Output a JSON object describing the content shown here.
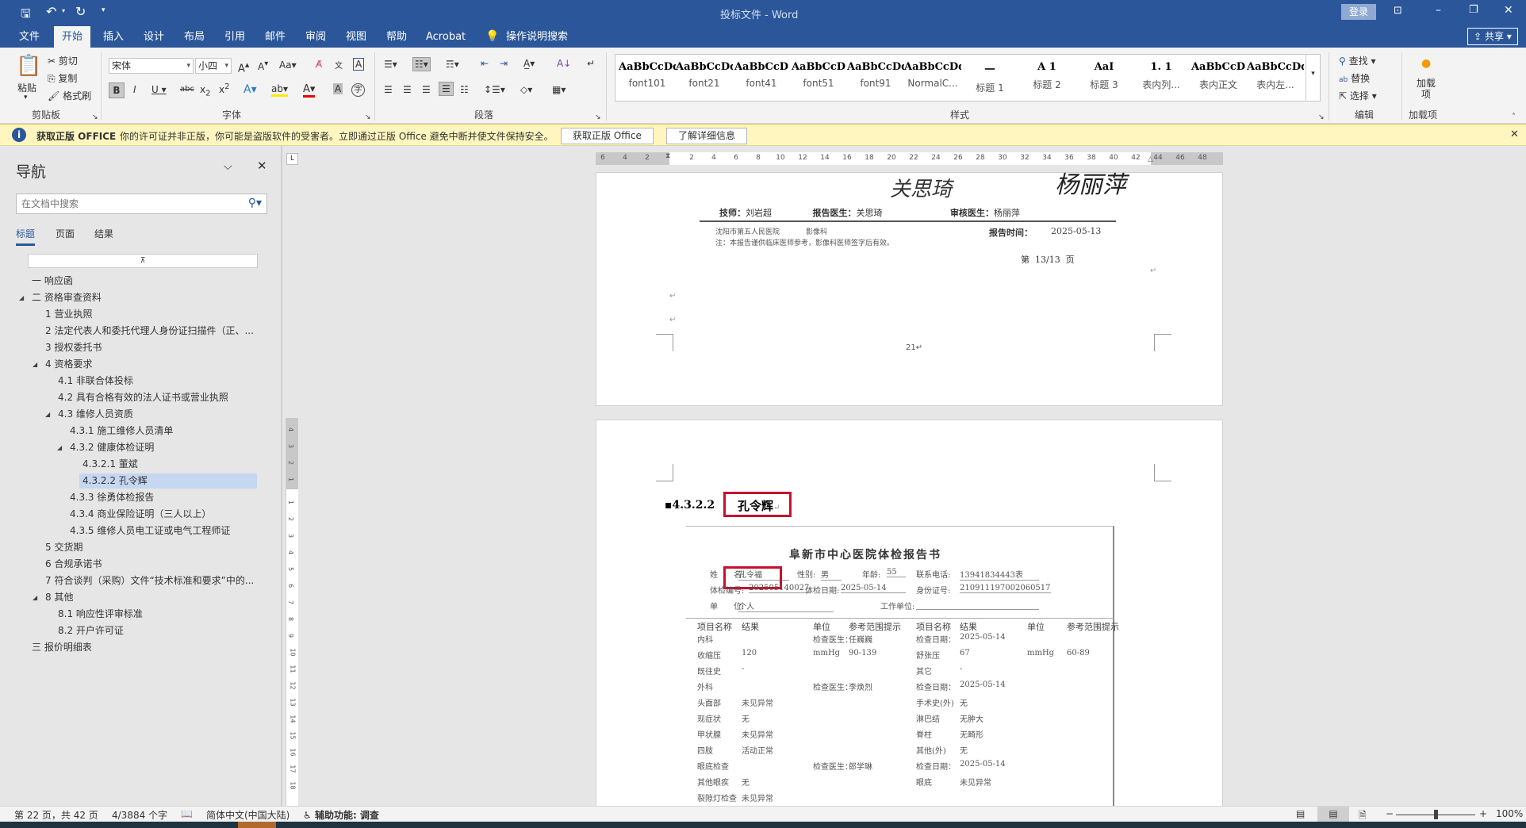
{
  "titlebar": {
    "title": "投标文件 - Word",
    "login": "登录",
    "share": "共享"
  },
  "tabs": [
    "文件",
    "开始",
    "插入",
    "设计",
    "布局",
    "引用",
    "邮件",
    "审阅",
    "视图",
    "帮助",
    "Acrobat"
  ],
  "tell_me": "操作说明搜索",
  "ribbon": {
    "clipboard": {
      "paste": "粘贴",
      "cut": "剪切",
      "copy": "复制",
      "format_painter": "格式刷",
      "label": "剪贴板"
    },
    "font": {
      "name": "宋体",
      "size": "小四",
      "label": "字体"
    },
    "paragraph": {
      "label": "段落"
    },
    "styles": {
      "label": "样式",
      "items": [
        {
          "preview": "AaBbCcDd",
          "name": "font101"
        },
        {
          "preview": "AaBbCcDdI",
          "name": "font21"
        },
        {
          "preview": "AaBbCcD",
          "name": "font41"
        },
        {
          "preview": "AaBbCcD",
          "name": "font51"
        },
        {
          "preview": "AaBbCcDd",
          "name": "font91"
        },
        {
          "preview": "AaBbCcDd",
          "name": "NormalC..."
        },
        {
          "preview": "一",
          "name": "标题 1"
        },
        {
          "preview": "A 1",
          "name": "标题 2"
        },
        {
          "preview": "AaI",
          "name": "标题 3"
        },
        {
          "preview": "1. 1",
          "name": "表内列..."
        },
        {
          "preview": "AaBbCcD",
          "name": "表内正文"
        },
        {
          "preview": "AaBbCcDd",
          "name": "表内左..."
        }
      ]
    },
    "editing": {
      "find": "查找",
      "replace": "替换",
      "select": "选择",
      "label": "编辑"
    },
    "addins": {
      "button": "加载项",
      "label": "加载项"
    }
  },
  "infobar": {
    "title": "获取正版 OFFICE",
    "message": "你的许可证并非正版，你可能是盗版软件的受害者。立即通过正版 Office 避免中断并使文件保持安全。",
    "btn_get": "获取正版 Office",
    "btn_learn": "了解详细信息"
  },
  "nav": {
    "title": "导航",
    "search_placeholder": "在文档中搜索",
    "tabs": [
      "标题",
      "页面",
      "结果"
    ],
    "items": [
      {
        "label": "一 响应函",
        "level": 0,
        "exp": false
      },
      {
        "label": "二 资格审查资料",
        "level": 0,
        "exp": true
      },
      {
        "label": "1 营业执照",
        "level": 1,
        "exp": false
      },
      {
        "label": "2 法定代表人和委托代理人身份证扫描件（正、...",
        "level": 1,
        "exp": false
      },
      {
        "label": "3 授权委托书",
        "level": 1,
        "exp": false
      },
      {
        "label": "4 资格要求",
        "level": 1,
        "exp": true
      },
      {
        "label": "4.1 非联合体投标",
        "level": 2,
        "exp": false
      },
      {
        "label": "4.2 具有合格有效的法人证书或营业执照",
        "level": 2,
        "exp": false
      },
      {
        "label": "4.3 维修人员资质",
        "level": 2,
        "exp": true
      },
      {
        "label": "4.3.1 施工维修人员清单",
        "level": 3,
        "exp": false
      },
      {
        "label": "4.3.2 健康体检证明",
        "level": 3,
        "exp": true
      },
      {
        "label": "4.3.2.1 董斌",
        "level": 4,
        "exp": false
      },
      {
        "label": "4.3.2.2 孔令辉",
        "level": 4,
        "exp": false,
        "selected": true
      },
      {
        "label": "4.3.3 徐勇体检报告",
        "level": 3,
        "exp": false
      },
      {
        "label": "4.3.4 商业保险证明（三人以上）",
        "level": 3,
        "exp": false
      },
      {
        "label": "4.3.5 维修人员电工证或电气工程师证",
        "level": 3,
        "exp": false
      },
      {
        "label": "5 交货期",
        "level": 1,
        "exp": false
      },
      {
        "label": "6 合规承诺书",
        "level": 1,
        "exp": false
      },
      {
        "label": "7 符合谈判（采购）文件“技术标准和要求”中的...",
        "level": 1,
        "exp": false
      },
      {
        "label": "8 其他",
        "level": 1,
        "exp": true
      },
      {
        "label": "8.1 响应性评审标准",
        "level": 2,
        "exp": false
      },
      {
        "label": "8.2 开户许可证",
        "level": 2,
        "exp": false
      },
      {
        "label": "三 报价明细表",
        "level": 0,
        "exp": false
      }
    ]
  },
  "ruler_ticks": [
    "6",
    "4",
    "2",
    "2",
    "4",
    "6",
    "8",
    "10",
    "12",
    "14",
    "16",
    "18",
    "20",
    "22",
    "24",
    "26",
    "28",
    "30",
    "32",
    "34",
    "36",
    "38",
    "40",
    "42",
    "44",
    "46",
    "48"
  ],
  "vruler_ticks": [
    "4",
    "3",
    "2",
    "1",
    "1",
    "2",
    "3",
    "4",
    "5",
    "6",
    "7",
    "8",
    "9",
    "10",
    "11",
    "12",
    "13",
    "14",
    "15",
    "16",
    "17",
    "18"
  ],
  "page1": {
    "tech": "技师：",
    "tech_name": "刘岩超",
    "doctor": "报告医生：",
    "doctor_name": "关思琦",
    "reviewer": "审核医生：",
    "reviewer_name": "杨丽萍",
    "hospital": "沈阳市第五人民医院",
    "dept": "影像科",
    "report_time_label": "报告时间：",
    "report_time": "2025-05-13",
    "note": "注：本报告谨供临床医师参考，影像科医师签字后有效。",
    "page_of": "第  13/13  页",
    "page_num": "21"
  },
  "page2": {
    "heading_num": "4.3.2.2",
    "heading_name": "孔令辉",
    "report": {
      "title": "阜新市中心医院体检报告书",
      "name_label": "姓　　名:",
      "name": "孔令福",
      "sex_label": "性别:",
      "sex": "男",
      "age_label": "年龄:",
      "age": "55",
      "phone_label": "联系电话:",
      "phone": "13941834443表",
      "exam_no_label": "体检编号:",
      "exam_no": "202505140027",
      "exam_date_label": "体检日期:",
      "exam_date": "2025-05-14",
      "id_label": "身份证号:",
      "id": "210911197002060517",
      "unit_label": "单　　位:",
      "unit": "个人",
      "work_label": "工作单位:",
      "headers": [
        "项目名称",
        "结果",
        "单位",
        "参考范围提示",
        "项目名称",
        "结果",
        "单位",
        "参考范围提示"
      ],
      "rows": [
        [
          "内科",
          "",
          "检查医生：",
          "任巍巍",
          "检查日期：",
          "2025-05-14",
          "",
          ""
        ],
        [
          "收缩压",
          "120",
          "mmHg",
          "90-139",
          "舒张压",
          "67",
          "mmHg",
          "60-89"
        ],
        [
          "既往史",
          "-",
          "",
          "",
          "其它",
          "-",
          "",
          ""
        ],
        [
          "外科",
          "",
          "检查医生：",
          "李焕烈",
          "检查日期：",
          "2025-05-14",
          "",
          ""
        ],
        [
          "头面部",
          "未见异常",
          "",
          "",
          "手术史(外)",
          "无",
          "",
          ""
        ],
        [
          "现症状",
          "无",
          "",
          "",
          "淋巴结",
          "无肿大",
          "",
          ""
        ],
        [
          "甲状腺",
          "未见异常",
          "",
          "",
          "脊柱",
          "无畸形",
          "",
          ""
        ],
        [
          "四肢",
          "活动正常",
          "",
          "",
          "其他(外)",
          "无",
          "",
          ""
        ],
        [
          "眼底检查",
          "",
          "检查医生：",
          "郎学琳",
          "检查日期：",
          "2025-05-14",
          "",
          ""
        ],
        [
          "其他眼疾",
          "无",
          "",
          "",
          "眼底",
          "未见异常",
          "",
          ""
        ],
        [
          "裂隙灯检查",
          "未见异常",
          "",
          "",
          "",
          "",
          "",
          ""
        ]
      ]
    }
  },
  "status": {
    "page": "第 22 页，共 42 页",
    "words": "4/3884 个字",
    "language": "简体中文(中国大陆)",
    "accessibility": "辅助功能: 调查",
    "zoom": "100%",
    "zoom_value": 100
  },
  "colors": {
    "accent": "#2b579a",
    "highlight_box": "#c8102e",
    "nav_selected": "#c5d7f1"
  }
}
